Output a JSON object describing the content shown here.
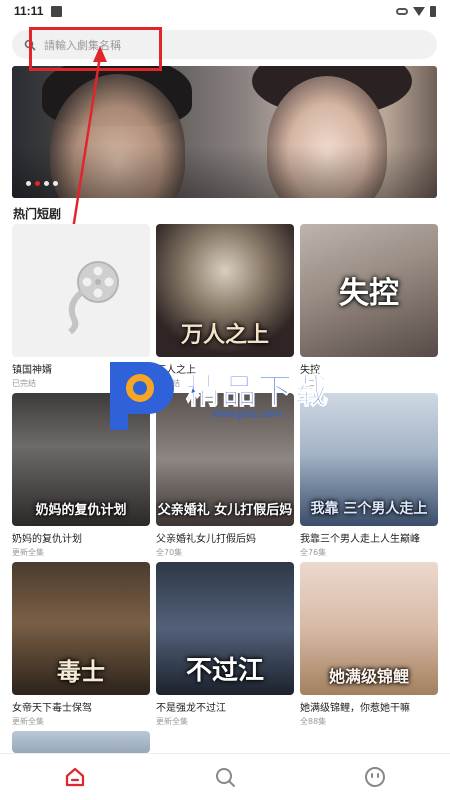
{
  "status_bar": {
    "time": "11:11"
  },
  "search": {
    "placeholder": "請輸入劇集名稱"
  },
  "banner": {
    "active_dot": 1,
    "dot_count": 4
  },
  "section": {
    "title": "热门短剧"
  },
  "dramas": [
    {
      "title": "镇国神婿",
      "status": "已完结",
      "poster_text": ""
    },
    {
      "title": "万人之上",
      "status": "已完结",
      "poster_text": "万人之上"
    },
    {
      "title": "失控",
      "status": "全集",
      "poster_text": "失控"
    },
    {
      "title": "奶妈的复仇计划",
      "status": "更新全集",
      "poster_text": "奶妈的复仇计划"
    },
    {
      "title": "父亲婚礼女儿打假后妈",
      "status": "全70集",
      "poster_text": "父亲婚礼 女儿打假后妈"
    },
    {
      "title": "我靠三个男人走上人生巅峰",
      "status": "全76集",
      "poster_text": "我靠 三个男人走上"
    },
    {
      "title": "女帝天下毒士保驾",
      "status": "更新全集",
      "poster_text": "毒士"
    },
    {
      "title": "不是强龙不过江",
      "status": "更新全集",
      "poster_text": "不过江"
    },
    {
      "title": "她满级锦鲤，你惹她干嘛",
      "status": "全88集",
      "poster_text": "她满级锦鲤"
    }
  ],
  "watermark": {
    "text": "精品下载",
    "url": "www.jpxz.com"
  },
  "nav": [
    {
      "icon": "home-icon",
      "active": true
    },
    {
      "icon": "search-icon",
      "active": false
    },
    {
      "icon": "profile-icon",
      "active": false
    }
  ],
  "colors": {
    "accent": "#e1262b",
    "annotation": "#e1262b",
    "watermark": "#2f62d8"
  }
}
